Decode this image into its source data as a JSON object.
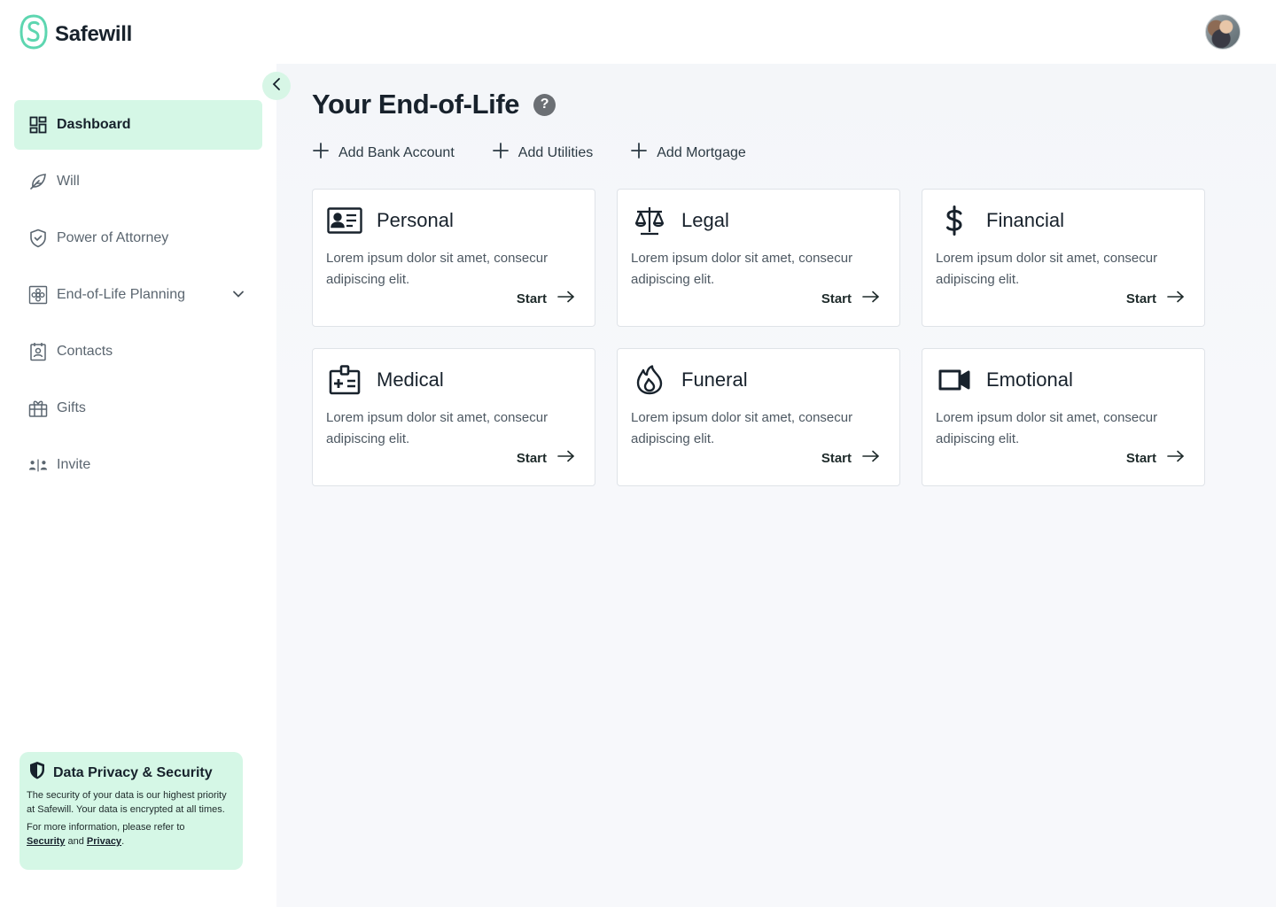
{
  "app": {
    "name": "Safewill"
  },
  "sidebar": {
    "items": [
      {
        "label": "Dashboard",
        "icon": "dashboard-icon",
        "active": true
      },
      {
        "label": "Will",
        "icon": "feather-icon"
      },
      {
        "label": "Power of Attorney",
        "icon": "shield-check-icon"
      },
      {
        "label": "End-of-Life Planning",
        "icon": "flower-icon",
        "expandable": true
      },
      {
        "label": "Contacts",
        "icon": "contact-book-icon"
      },
      {
        "label": "Gifts",
        "icon": "gift-icon"
      },
      {
        "label": "Invite",
        "icon": "invite-users-icon"
      }
    ],
    "privacy": {
      "title": "Data Privacy & Security",
      "body": "The security of your data is our highest priority at Safewill. Your data is encrypted at all times.",
      "more_prefix": "For more information, please refer to",
      "security_link": "Security",
      "and": "and",
      "privacy_link": "Privacy",
      "suffix": "."
    }
  },
  "main": {
    "title": "Your End-of-Life",
    "help_symbol": "?",
    "actions": [
      {
        "label": "Add Bank Account"
      },
      {
        "label": "Add Utilities"
      },
      {
        "label": "Add Mortgage"
      }
    ],
    "cards": [
      {
        "title": "Personal",
        "icon": "id-card-icon",
        "desc": "Lorem ipsum dolor sit amet, consecur adipiscing elit.",
        "cta": "Start"
      },
      {
        "title": "Legal",
        "icon": "scales-icon",
        "desc": "Lorem ipsum dolor sit amet, consecur adipiscing elit.",
        "cta": "Start"
      },
      {
        "title": "Financial",
        "icon": "dollar-icon",
        "desc": "Lorem ipsum dolor sit amet, consecur adipiscing elit.",
        "cta": "Start"
      },
      {
        "title": "Medical",
        "icon": "medical-card-icon",
        "desc": "Lorem ipsum dolor sit amet, consecur adipiscing elit.",
        "cta": "Start"
      },
      {
        "title": "Funeral",
        "icon": "flame-icon",
        "desc": "Lorem ipsum dolor sit amet, consecur adipiscing elit.",
        "cta": "Start"
      },
      {
        "title": "Emotional",
        "icon": "video-camera-icon",
        "desc": "Lorem ipsum dolor sit amet, consecur adipiscing elit.",
        "cta": "Start"
      }
    ]
  },
  "colors": {
    "accent": "#d5f7e6",
    "brand": "#4fd1a8",
    "text": "#18222c",
    "background": "#f7f8fb"
  }
}
